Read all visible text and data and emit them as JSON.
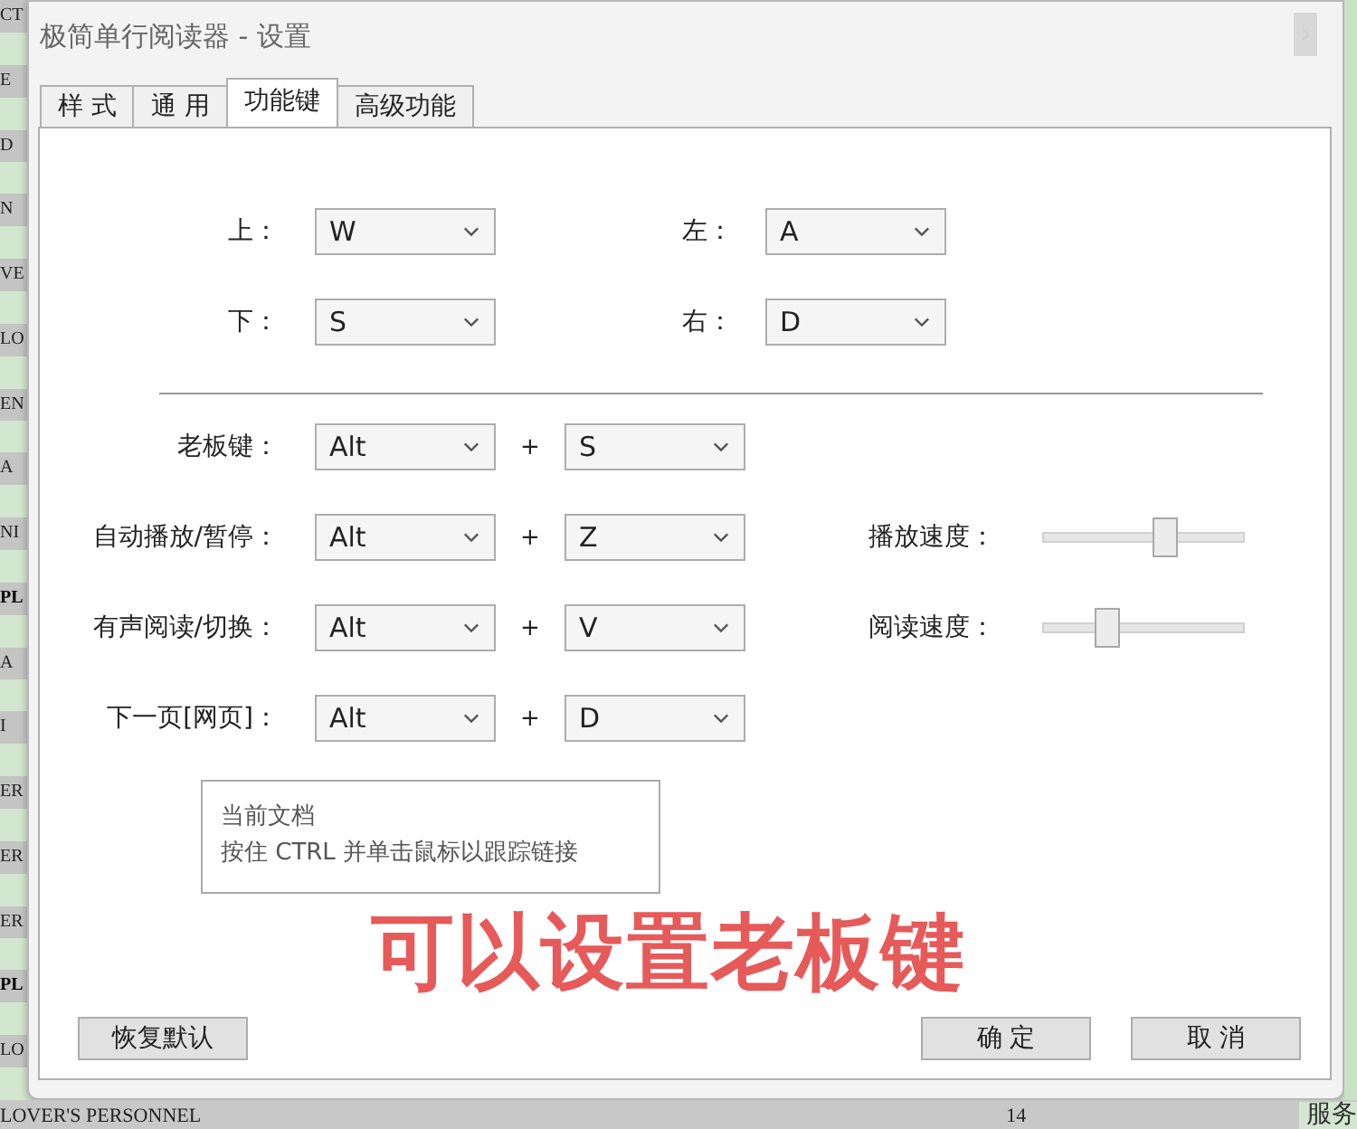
{
  "window": {
    "title": "极简单行阅读器 - 设置"
  },
  "tabs": [
    {
      "label": "样 式",
      "selected": false
    },
    {
      "label": "通 用",
      "selected": false
    },
    {
      "label": "功能键",
      "selected": true
    },
    {
      "label": "高级功能",
      "selected": false
    }
  ],
  "direction_keys": [
    [
      {
        "label": "上：",
        "value": "W"
      },
      {
        "label": "左：",
        "value": "A"
      }
    ],
    [
      {
        "label": "下：",
        "value": "S"
      },
      {
        "label": "右：",
        "value": "D"
      }
    ]
  ],
  "hotkeys": [
    {
      "label": "老板键：",
      "modifier": "Alt",
      "plus": "+",
      "key": "S"
    },
    {
      "label": "自动播放/暂停：",
      "modifier": "Alt",
      "plus": "+",
      "key": "Z",
      "speed": {
        "label": "播放速度：",
        "level": 0.62
      }
    },
    {
      "label": "有声阅读/切换：",
      "modifier": "Alt",
      "plus": "+",
      "key": "V",
      "speed": {
        "label": "阅读速度：",
        "level": 0.3
      }
    },
    {
      "label": "下一页[网页]：",
      "modifier": "Alt",
      "plus": "+",
      "key": "D"
    }
  ],
  "tooltip": {
    "lines": [
      "当前文档",
      "按住 CTRL 并单击鼠标以跟踪链接"
    ]
  },
  "annotation": "可以设置老板键",
  "buttons": [
    {
      "label": "恢复默认",
      "kind": "left"
    },
    {
      "label": "确 定",
      "kind": "right"
    },
    {
      "label": "取 消",
      "kind": "right"
    }
  ],
  "background": {
    "left_fragments": [
      {
        "text": "CT",
        "bold": false
      },
      {
        "text": "E",
        "bold": false
      },
      {
        "text": "D",
        "bold": false
      },
      {
        "text": "N",
        "bold": false
      },
      {
        "text": "VE",
        "bold": false
      },
      {
        "text": "LO",
        "bold": false
      },
      {
        "text": "EN",
        "bold": false
      },
      {
        "text": "A",
        "bold": false
      },
      {
        "text": "NI",
        "bold": false
      },
      {
        "text": "PL",
        "bold": true
      },
      {
        "text": "A",
        "bold": false
      },
      {
        "text": "I",
        "bold": false
      },
      {
        "text": "ER",
        "bold": false
      },
      {
        "text": "ER",
        "bold": false
      },
      {
        "text": "ER",
        "bold": false
      },
      {
        "text": "PL",
        "bold": true
      },
      {
        "text": "LO",
        "bold": false
      }
    ],
    "bottom_row": [
      "LOVER'S PERSONNEL",
      "14",
      "服务"
    ]
  }
}
